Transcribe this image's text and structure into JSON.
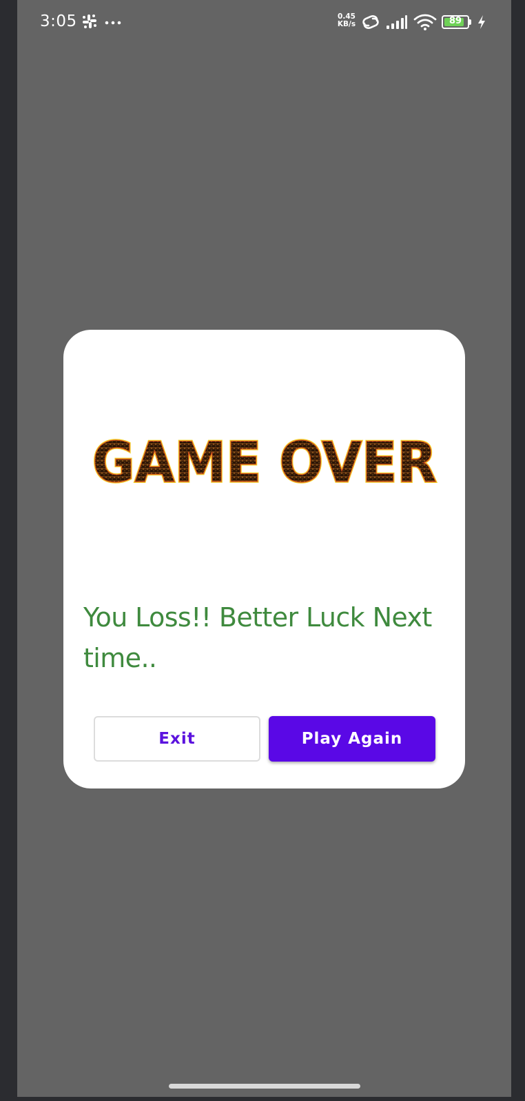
{
  "status_bar": {
    "time": "3:05",
    "network_speed_value": "0.45",
    "network_speed_unit": "KB/s",
    "battery_level": "89",
    "battery_fraction": 0.89,
    "icons": [
      "slack-icon",
      "more-icon",
      "link-icon",
      "signal-icon",
      "wifi-icon",
      "battery-icon",
      "charging-bolt-icon"
    ]
  },
  "dialog": {
    "image_text": "GAME OVER",
    "message": "You Loss!! Better Luck Next time..",
    "exit_label": "Exit",
    "play_again_label": "Play Again"
  },
  "colors": {
    "background_dim": "#646464",
    "dialog_bg": "#ffffff",
    "message_green": "#3f8a3e",
    "primary_purple": "#5a08e6",
    "battery_green": "#6fd157"
  }
}
